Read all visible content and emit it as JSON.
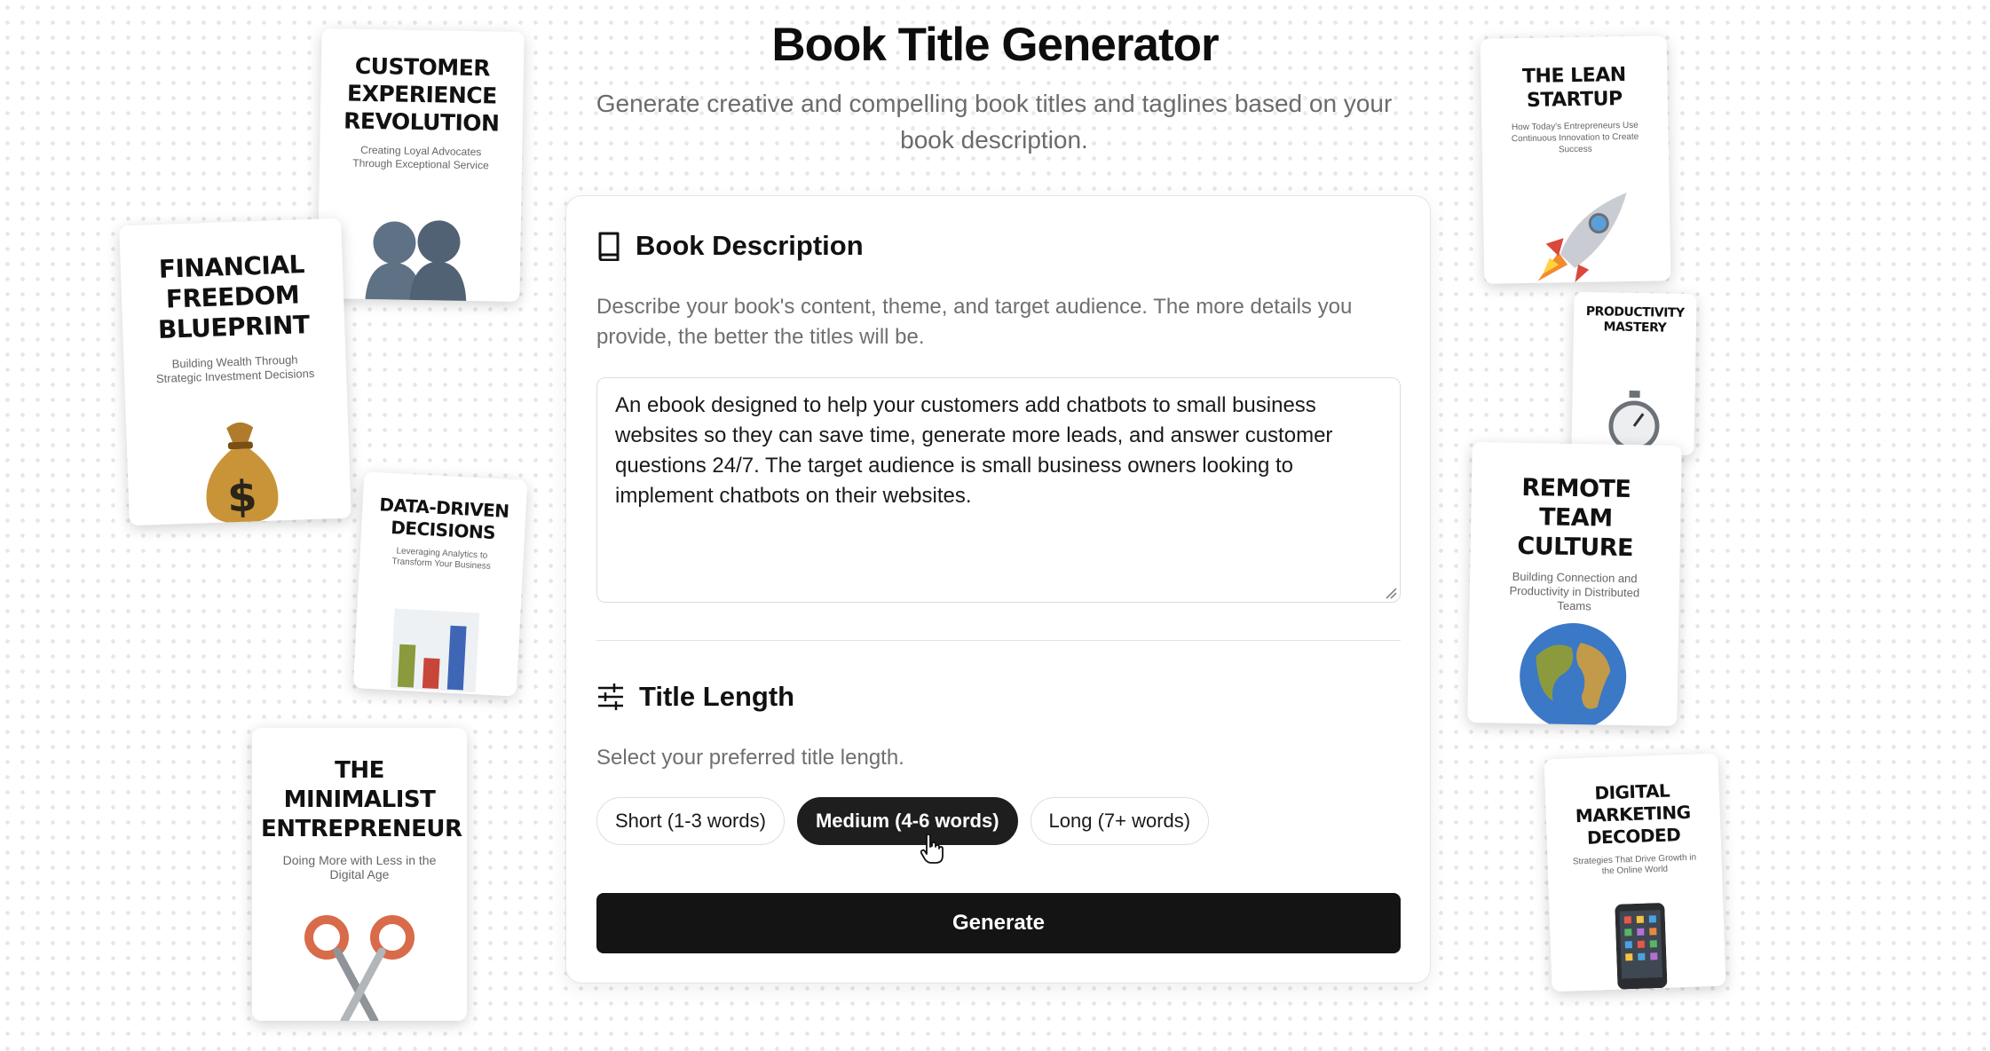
{
  "header": {
    "title": "Book Title Generator",
    "subtitle": "Generate creative and compelling book titles and taglines based on your book description."
  },
  "description_section": {
    "title": "Book Description",
    "help_text": "Describe your book's content, theme, and target audience. The more details you provide, the better the titles will be.",
    "textarea_value": "An ebook designed to help your customers add chatbots to small business websites so they can save time, generate more leads, and answer customer questions 24/7. The target audience is small business owners looking to implement chatbots on their websites."
  },
  "length_section": {
    "title": "Title Length",
    "help_text": "Select your preferred title length.",
    "options": [
      "Short (1-3 words)",
      "Medium (4-6 words)",
      "Long (7+ words)"
    ],
    "selected": "Medium (4-6 words)"
  },
  "generate_label": "Generate",
  "books": {
    "customer_experience": {
      "title": "Customer Experience Revolution",
      "subtitle": "Creating Loyal Advocates Through Exceptional Service",
      "icon": "people-icon"
    },
    "financial_freedom": {
      "title": "Financial Freedom Blueprint",
      "subtitle": "Building Wealth Through Strategic Investment Decisions",
      "icon": "money-bag-icon"
    },
    "data_driven": {
      "title": "Data-Driven Decisions",
      "subtitle": "Leveraging Analytics to Transform Your Business",
      "icon": "bar-chart-icon"
    },
    "minimalist": {
      "title": "The Minimalist Entrepreneur",
      "subtitle": "Doing More with Less in the Digital Age",
      "icon": "scissors-icon"
    },
    "lean_startup": {
      "title": "The Lean Startup",
      "subtitle": "How Today's Entrepreneurs Use Continuous Innovation to Create Success",
      "icon": "rocket-icon"
    },
    "productivity": {
      "title": "Productivity Mastery",
      "subtitle": "",
      "icon": "stopwatch-icon"
    },
    "remote_team": {
      "title": "Remote Team Culture",
      "subtitle": "Building Connection and Productivity in Distributed Teams",
      "icon": "globe-icon"
    },
    "digital_marketing": {
      "title": "Digital Marketing Decoded",
      "subtitle": "Strategies That Drive Growth in the Online World",
      "icon": "phone-icon"
    }
  },
  "colors": {
    "primary": "#141414",
    "muted_text": "#6b6b6b",
    "border": "#e4e4e4"
  }
}
